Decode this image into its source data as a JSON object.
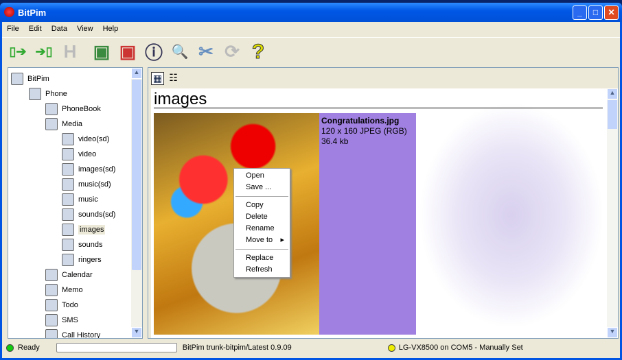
{
  "window": {
    "title": "BitPim"
  },
  "menu": [
    "File",
    "Edit",
    "Data",
    "View",
    "Help"
  ],
  "toolbar": [
    {
      "icon": "phone-get-icon",
      "glyph": "▯➔"
    },
    {
      "icon": "phone-send-icon",
      "glyph": "➔▯"
    },
    {
      "icon": "history-icon",
      "glyph": "H"
    },
    {
      "icon": "add-image-icon",
      "glyph": "▣"
    },
    {
      "icon": "delete-image-icon",
      "glyph": "▣"
    },
    {
      "icon": "info-icon",
      "glyph": "ⓘ"
    },
    {
      "icon": "phone-detect-icon",
      "glyph": "🔍"
    },
    {
      "icon": "settings-tools-icon",
      "glyph": "✂"
    },
    {
      "icon": "refresh-icon",
      "glyph": "⟳"
    },
    {
      "icon": "help-icon",
      "glyph": "?"
    }
  ],
  "tree": [
    {
      "label": "BitPim",
      "level": 0
    },
    {
      "label": "Phone",
      "level": 1
    },
    {
      "label": "PhoneBook",
      "level": 2
    },
    {
      "label": "Media",
      "level": 2
    },
    {
      "label": "video(sd)",
      "level": 3
    },
    {
      "label": "video",
      "level": 3
    },
    {
      "label": "images(sd)",
      "level": 3
    },
    {
      "label": "music(sd)",
      "level": 3
    },
    {
      "label": "music",
      "level": 3
    },
    {
      "label": "sounds(sd)",
      "level": 3
    },
    {
      "label": "images",
      "level": 3,
      "selected": true
    },
    {
      "label": "sounds",
      "level": 3
    },
    {
      "label": "ringers",
      "level": 3
    },
    {
      "label": "Calendar",
      "level": 2
    },
    {
      "label": "Memo",
      "level": 2
    },
    {
      "label": "Todo",
      "level": 2
    },
    {
      "label": "SMS",
      "level": 2
    },
    {
      "label": "Call History",
      "level": 2
    }
  ],
  "main": {
    "heading": "images",
    "file": {
      "name": "Congratulations.jpg",
      "dims": "120 x 160 JPEG (RGB)",
      "size": "36.4 kb"
    }
  },
  "context_menu": [
    "Open",
    "Save ...",
    "Copy",
    "Delete",
    "Rename",
    "Move to",
    "Replace",
    "Refresh"
  ],
  "status": {
    "state": "Ready",
    "version": "BitPim trunk-bitpim/Latest 0.9.09",
    "phone": "LG-VX8500 on COM5 - Manually Set"
  }
}
